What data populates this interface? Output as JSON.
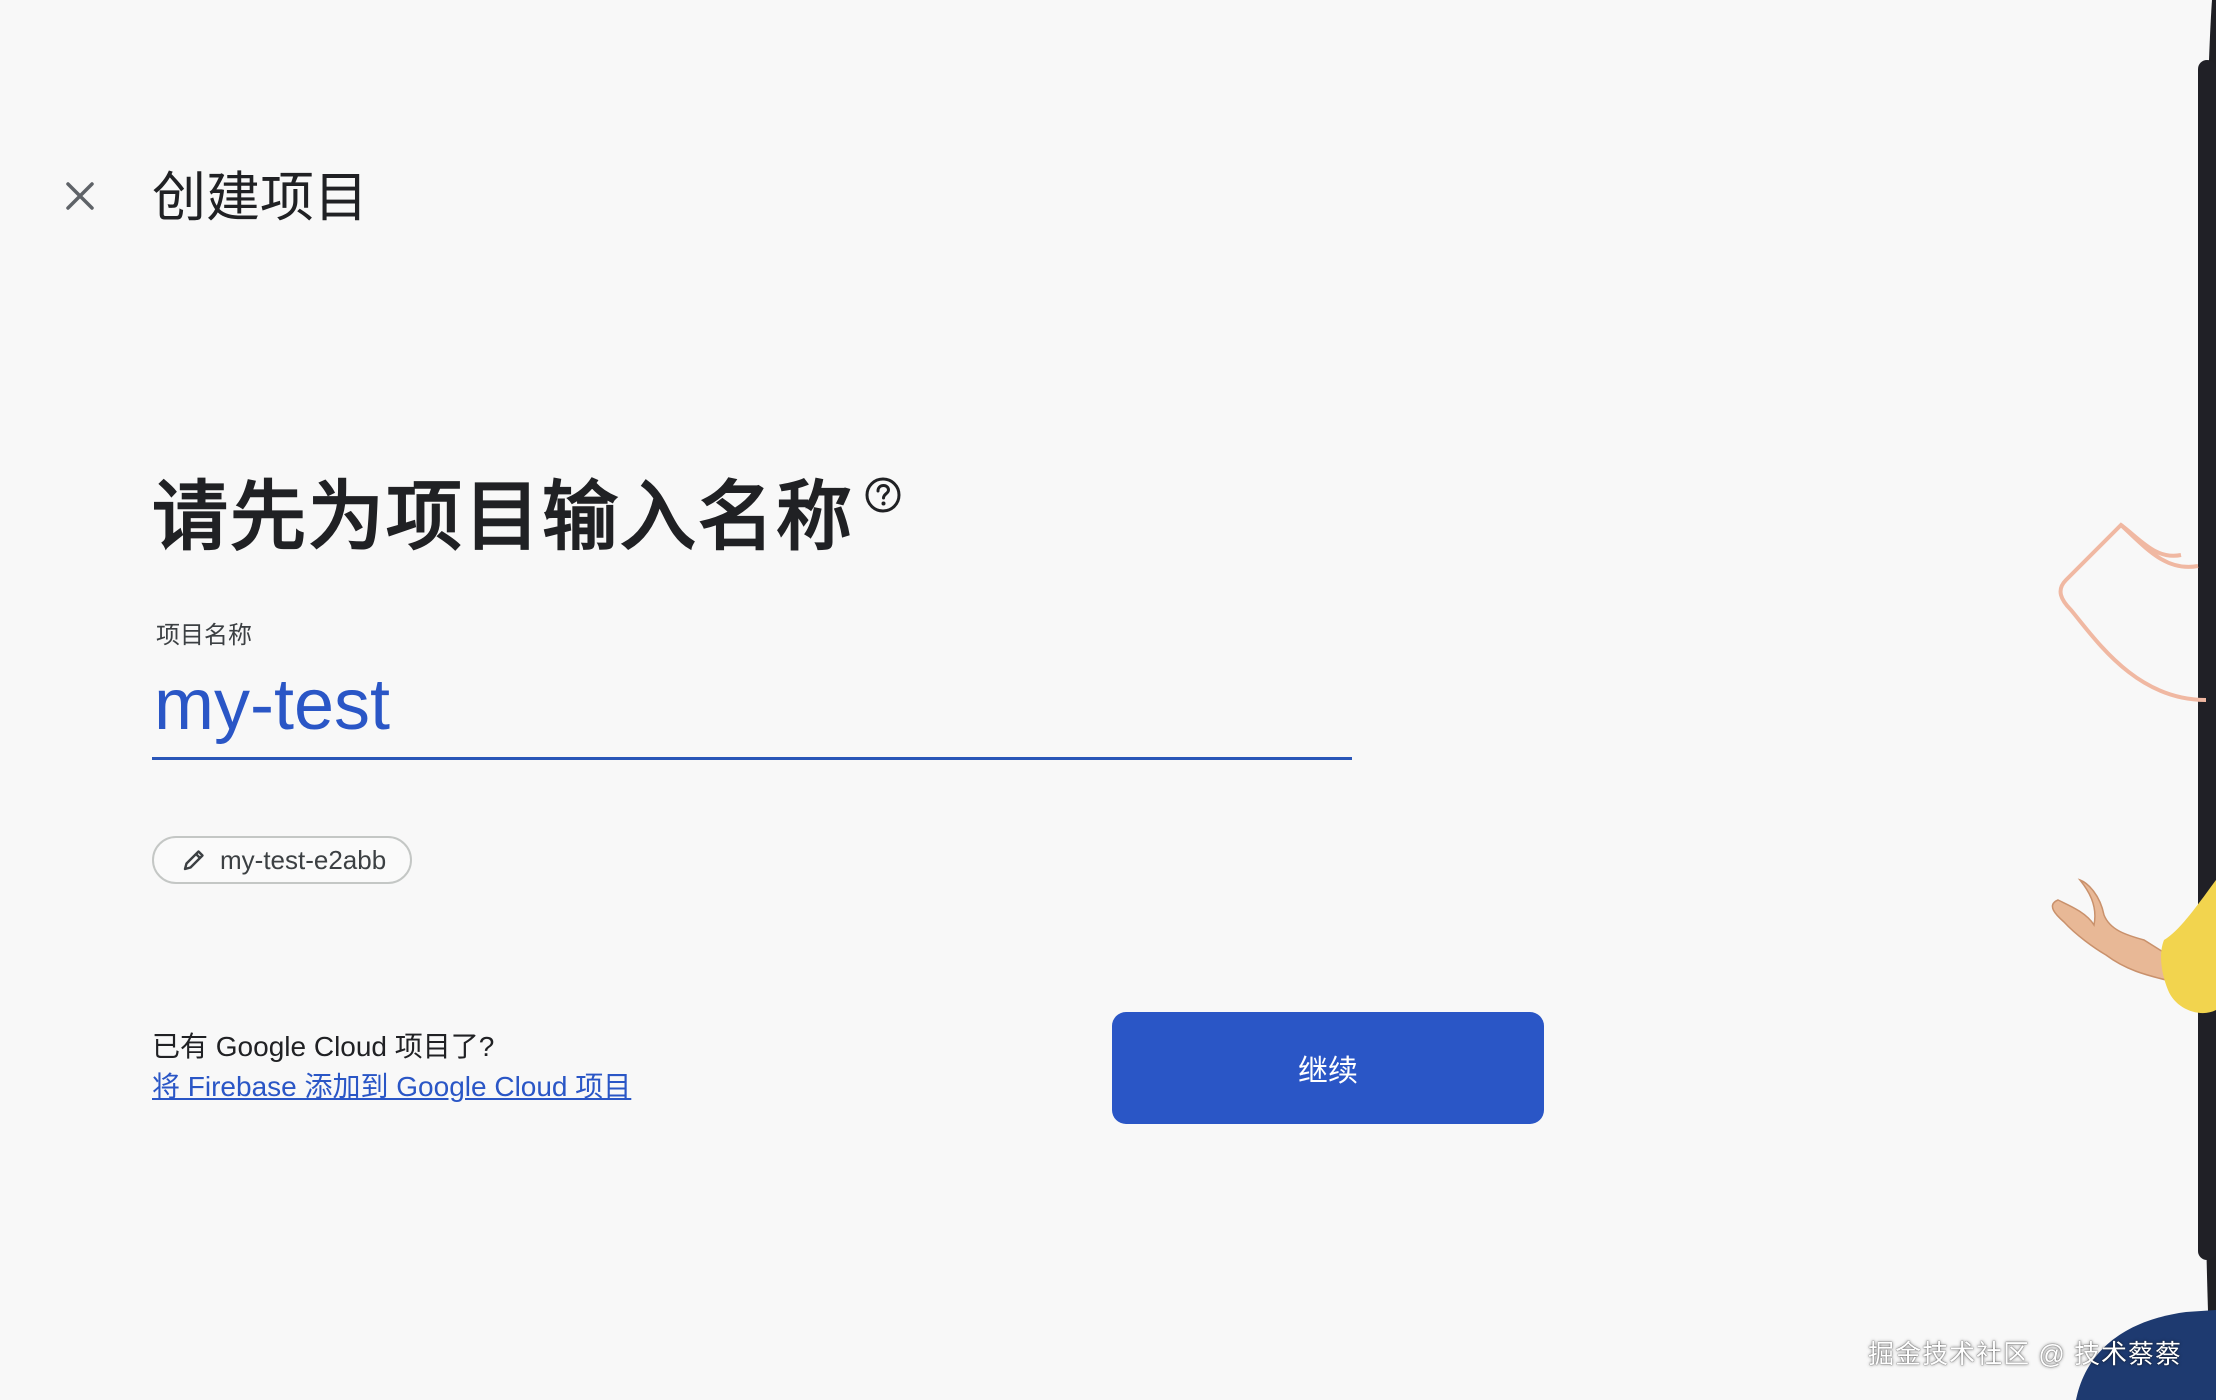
{
  "header": {
    "title": "创建项目",
    "close_icon": "close-icon"
  },
  "main": {
    "heading": "请先为项目输入名称",
    "help_icon": "help-circle-icon",
    "project_name": {
      "label": "项目名称",
      "value": "my-test"
    },
    "project_id": {
      "icon": "pencil-icon",
      "value": "my-test-e2abb"
    }
  },
  "footer": {
    "existing_question": "已有 Google Cloud 项目了?",
    "existing_link": "将 Firebase 添加到 Google Cloud 项目",
    "continue_label": "继续"
  },
  "watermark": "掘金技术社区 @ 技术蔡蔡",
  "colors": {
    "accent": "#2a56c6",
    "background": "#f8f8f8",
    "text": "#202124"
  }
}
